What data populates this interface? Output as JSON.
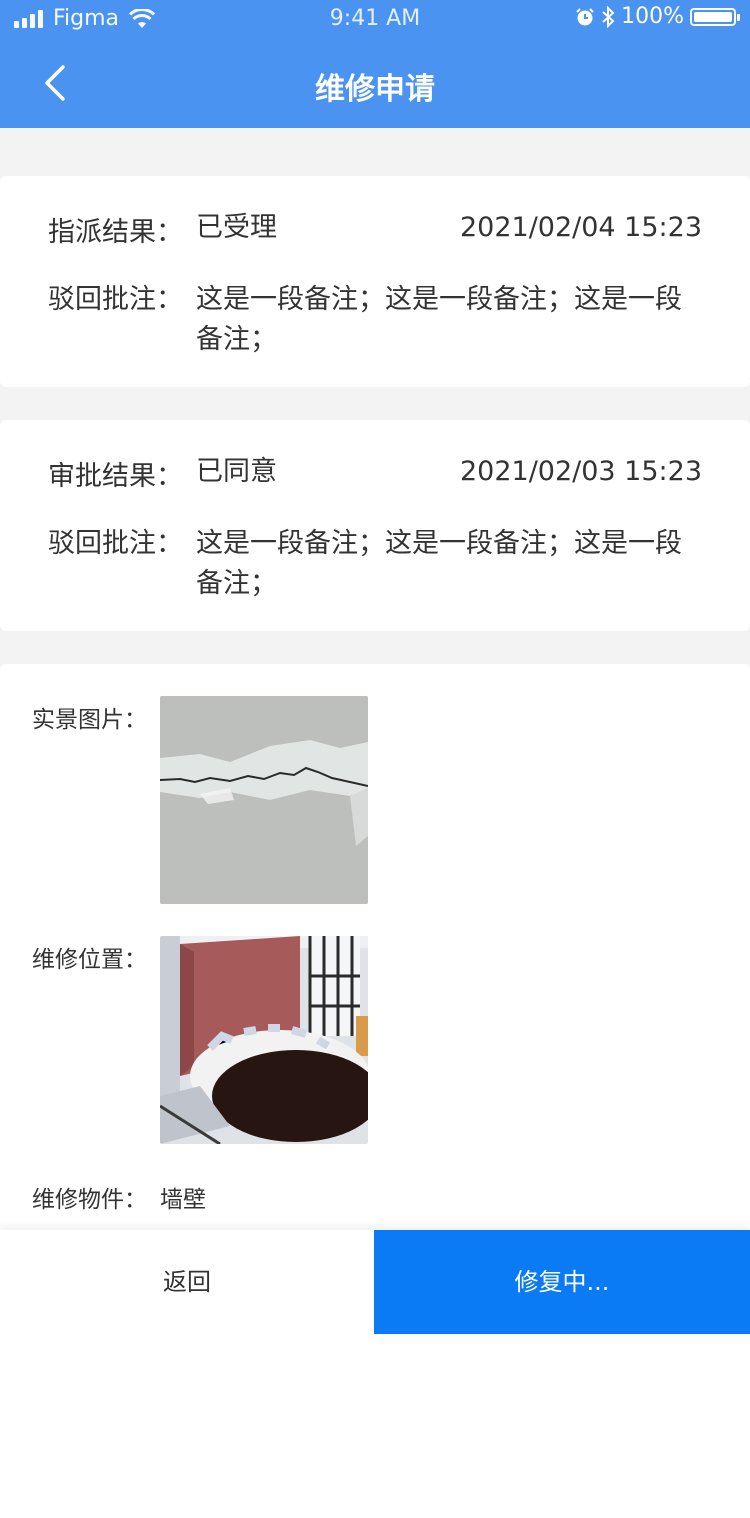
{
  "status_bar": {
    "carrier": "Figma",
    "time": "9:41 AM",
    "battery": "100%"
  },
  "nav": {
    "title": "维修申请"
  },
  "dispatch": {
    "result_label": "指派结果：",
    "result_value": "已受理",
    "date": "2021/02/04 15:23",
    "note_label": "驳回批注：",
    "note_value": "这是一段备注；这是一段备注；这是一段备注；"
  },
  "approval": {
    "result_label": "审批结果：",
    "result_value": "已同意",
    "date": "2021/02/03 15:23",
    "note_label": "驳回批注：",
    "note_value": "这是一段备注；这是一段备注；这是一段备注；"
  },
  "details": {
    "photo_label": "实景图片：",
    "location_label": "维修位置：",
    "component_label": "维修物件：",
    "component_value": "墙壁"
  },
  "footer": {
    "back_label": "返回",
    "primary_label": "修复中..."
  },
  "colors": {
    "header": "#4a93f0",
    "primary_button": "#0a7bf5"
  }
}
